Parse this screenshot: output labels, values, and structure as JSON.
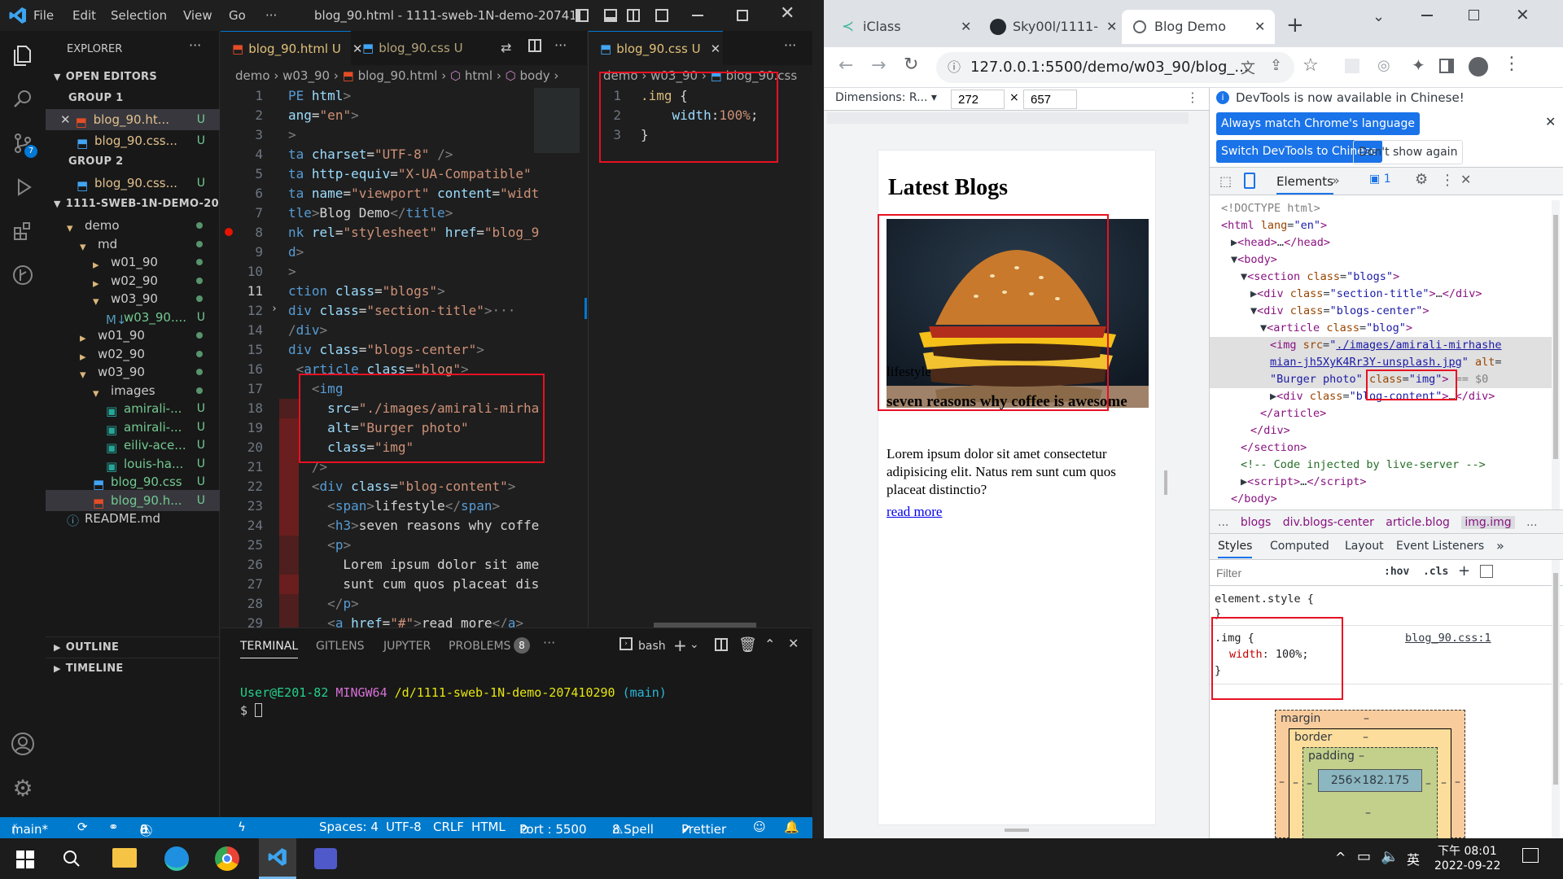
{
  "vscode": {
    "menu": [
      "File",
      "Edit",
      "Selection",
      "View",
      "Go",
      "···"
    ],
    "window_title": "blog_90.html - 1111-sweb-1N-demo-2074102...",
    "explorer": {
      "title": "EXPLORER",
      "open_editors": "OPEN EDITORS",
      "group1": "GROUP 1",
      "group1_items": [
        {
          "name": "blog_90.ht...",
          "badge": "U"
        },
        {
          "name": "blog_90.css...",
          "badge": "U"
        }
      ],
      "group2": "GROUP 2",
      "group2_items": [
        {
          "name": "blog_90.css...",
          "badge": "U"
        }
      ],
      "project": "1111-SWEB-1N-DEMO-20...",
      "tree": [
        {
          "name": "demo",
          "depth": 1,
          "kind": "folder-open"
        },
        {
          "name": "md",
          "depth": 2,
          "kind": "folder-open"
        },
        {
          "name": "w01_90",
          "depth": 3,
          "kind": "folder"
        },
        {
          "name": "w02_90",
          "depth": 3,
          "kind": "folder"
        },
        {
          "name": "w03_90",
          "depth": 3,
          "kind": "folder-open"
        },
        {
          "name": "w03_90....",
          "depth": 4,
          "kind": "md",
          "badge": "U"
        },
        {
          "name": "w01_90",
          "depth": 2,
          "kind": "folder"
        },
        {
          "name": "w02_90",
          "depth": 2,
          "kind": "folder"
        },
        {
          "name": "w03_90",
          "depth": 2,
          "kind": "folder-open"
        },
        {
          "name": "images",
          "depth": 3,
          "kind": "folder-open"
        },
        {
          "name": "amirali-...",
          "depth": 4,
          "kind": "img",
          "badge": "U"
        },
        {
          "name": "amirali-...",
          "depth": 4,
          "kind": "img",
          "badge": "U"
        },
        {
          "name": "eiliv-ace...",
          "depth": 4,
          "kind": "img",
          "badge": "U"
        },
        {
          "name": "louis-ha...",
          "depth": 4,
          "kind": "img",
          "badge": "U"
        },
        {
          "name": "blog_90.css",
          "depth": 3,
          "kind": "css",
          "badge": "U"
        },
        {
          "name": "blog_90.h...",
          "depth": 3,
          "kind": "html",
          "badge": "U"
        },
        {
          "name": "README.md",
          "depth": 1,
          "kind": "info"
        }
      ],
      "outline": "OUTLINE",
      "timeline": "TIMELINE"
    },
    "editor1": {
      "tabs": [
        {
          "label": "blog_90.html",
          "badge": "U"
        },
        {
          "label": "blog_90.css",
          "badge": "U"
        }
      ],
      "breadcrumb": [
        "demo",
        "w03_90",
        "blog_90.html",
        "html",
        "body"
      ],
      "lines": [
        {
          "n": "1",
          "html": "<span class='k'>PE</span> <span class='a'>html</span><span class='g'>&gt;</span>"
        },
        {
          "n": "2",
          "html": "<span class='a'>ang</span>=<span class='s'>\"en\"</span><span class='g'>&gt;</span>"
        },
        {
          "n": "3",
          "html": "<span class='g'>&gt;</span>"
        },
        {
          "n": "4",
          "html": "<span class='k'>ta</span> <span class='a'>charset</span>=<span class='s'>\"UTF-8\"</span> <span class='g'>/&gt;</span>"
        },
        {
          "n": "5",
          "html": "<span class='k'>ta</span> <span class='a'>http-equiv</span>=<span class='s'>\"X-UA-Compatible\"</span>"
        },
        {
          "n": "6",
          "html": "<span class='k'>ta</span> <span class='a'>name</span>=<span class='s'>\"viewport\"</span> <span class='a'>content</span>=<span class='s'>\"widt</span>"
        },
        {
          "n": "7",
          "html": "<span class='k'>tle</span><span class='g'>&gt;</span>Blog Demo<span class='g'>&lt;/</span><span class='k'>title</span><span class='g'>&gt;</span>"
        },
        {
          "n": "8",
          "html": "<span class='k'>nk</span> <span class='a'>rel</span>=<span class='s'>\"stylesheet\"</span> <span class='a'>href</span>=<span class='s'>\"blog_9</span>"
        },
        {
          "n": "9",
          "html": "<span class='k'>d</span><span class='g'>&gt;</span>"
        },
        {
          "n": "10",
          "html": "<span class='g'>&gt;</span>"
        },
        {
          "n": "11",
          "html": "<span class='k'>ction</span> <span class='a'>class</span>=<span class='s'>\"blogs\"</span><span class='g'>&gt;</span>"
        },
        {
          "n": "12",
          "html": "<span class='k'>div</span> <span class='a'>class</span>=<span class='s'>\"section-title\"</span><span class='g'>&gt;</span><span class='g'>···</span>"
        },
        {
          "n": "14",
          "html": "<span class='g'>/</span><span class='k'>div</span><span class='g'>&gt;</span>"
        },
        {
          "n": "15",
          "html": "<span class='k'>div</span> <span class='a'>class</span>=<span class='s'>\"blogs-center\"</span><span class='g'>&gt;</span>"
        },
        {
          "n": "16",
          "html": " <span class='g'>&lt;</span><span class='k'>article</span> <span class='a'>class</span>=<span class='s'>\"blog\"</span><span class='g'>&gt;</span>"
        },
        {
          "n": "17",
          "html": "   <span class='g'>&lt;</span><span class='k'>img</span>"
        },
        {
          "n": "18",
          "html": "     <span class='a'>src</span>=<span class='s'>\"./images/amirali-mirha</span>"
        },
        {
          "n": "19",
          "html": "     <span class='a'>alt</span>=<span class='s'>\"Burger photo\"</span>"
        },
        {
          "n": "20",
          "html": "     <span class='a'>class</span>=<span class='s'>\"img\"</span>"
        },
        {
          "n": "21",
          "html": "   <span class='g'>/&gt;</span>"
        },
        {
          "n": "22",
          "html": "   <span class='g'>&lt;</span><span class='k'>div</span> <span class='a'>class</span>=<span class='s'>\"blog-content\"</span><span class='g'>&gt;</span>"
        },
        {
          "n": "23",
          "html": "     <span class='g'>&lt;</span><span class='k'>span</span><span class='g'>&gt;</span>lifestyle<span class='g'>&lt;/</span><span class='k'>span</span><span class='g'>&gt;</span>"
        },
        {
          "n": "24",
          "html": "     <span class='g'>&lt;</span><span class='k'>h3</span><span class='g'>&gt;</span>seven reasons why coffe"
        },
        {
          "n": "25",
          "html": "     <span class='g'>&lt;</span><span class='k'>p</span><span class='g'>&gt;</span>"
        },
        {
          "n": "26",
          "html": "       Lorem ipsum dolor sit ame"
        },
        {
          "n": "27",
          "html": "       sunt cum quos placeat dis"
        },
        {
          "n": "28",
          "html": "     <span class='g'>&lt;/</span><span class='k'>p</span><span class='g'>&gt;</span>"
        },
        {
          "n": "29",
          "html": "     <span class='g'>&lt;</span><span class='k'>a</span> <span class='a'>href</span>=<span class='s'>\"#\"</span><span class='g'>&gt;</span>read more<span class='g'>&lt;/</span><span class='k'>a</span><span class='g'>&gt;</span>"
        }
      ]
    },
    "editor2": {
      "tab": {
        "label": "blog_90.css",
        "badge": "U"
      },
      "breadcrumb": [
        "demo",
        "w03_90",
        "blog_90.css"
      ],
      "lines": [
        {
          "n": "1",
          "html": "<span class='sel'>.img</span> <span class='t'>{</span>"
        },
        {
          "n": "2",
          "html": "    <span class='p'>width</span>:<span class='s'>100%</span>;"
        },
        {
          "n": "3",
          "html": "<span class='t'>}</span>"
        }
      ]
    },
    "panel": {
      "tabs": [
        "TERMINAL",
        "GITLENS",
        "JUPYTER",
        "PROBLEMS"
      ],
      "problems_count": "8",
      "shell": "bash",
      "prompt_user": "User@E201-82",
      "prompt_env": "MINGW64",
      "prompt_path": "/d/1111-sweb-1N-demo-207410290",
      "prompt_branch": "(main)",
      "prompt_symbol": "$"
    },
    "status": {
      "branch": "main*",
      "errors": "0",
      "warnings": "0",
      "info": "8",
      "spaces": "Spaces: 4",
      "encoding": "UTF-8",
      "eol": "CRLF",
      "lang": "HTML",
      "port": "Port : 5500",
      "spell": "8 Spell",
      "prettier": "Prettier"
    }
  },
  "chrome": {
    "tabs": [
      "iClass",
      "Sky00l/1111-",
      "Blog Demo"
    ],
    "url": "127.0.0.1:5500/demo/w03_90/blog_...",
    "dimensions_label": "Dimensions: R...",
    "width": "272",
    "height": "657",
    "page": {
      "heading": "Latest Blogs",
      "category": "lifestyle",
      "title": "seven reasons why coffee is awesome",
      "body": "Lorem ipsum dolor sit amet consectetur adipisicing elit. Natus rem sunt cum quos placeat distinctio?",
      "link": "read more"
    },
    "devtools": {
      "banner": "DevTools is now available in Chinese!",
      "btn1": "Always match Chrome's language",
      "btn2": "Switch DevTools to Chinese",
      "btn3": "Don't show again",
      "elements_tab": "Elements",
      "issues": "1",
      "dom": [
        {
          "indent": 0,
          "html": "<span class='g'>&lt;!DOCTYPE html&gt;</span>"
        },
        {
          "indent": 0,
          "html": "<span class='tg'>&lt;html</span> <span class='at'>lang</span>=<span class='av'>\"en\"</span><span class='tg'>&gt;</span>"
        },
        {
          "indent": 1,
          "html": "▶<span class='tg'>&lt;head&gt;</span>…<span class='tg'>&lt;/head&gt;</span>"
        },
        {
          "indent": 1,
          "html": "▼<span class='tg'>&lt;body&gt;</span>"
        },
        {
          "indent": 2,
          "html": "▼<span class='tg'>&lt;section</span> <span class='at'>class</span>=<span class='av'>\"blogs\"</span><span class='tg'>&gt;</span>"
        },
        {
          "indent": 3,
          "html": "▶<span class='tg'>&lt;div</span> <span class='at'>class</span>=<span class='av'>\"section-title\"</span><span class='tg'>&gt;</span>…<span class='tg'>&lt;/div&gt;</span>"
        },
        {
          "indent": 3,
          "html": "▼<span class='tg'>&lt;div</span> <span class='at'>class</span>=<span class='av'>\"blogs-center\"</span><span class='tg'>&gt;</span>"
        },
        {
          "indent": 4,
          "html": "▼<span class='tg'>&lt;article</span> <span class='at'>class</span>=<span class='av'>\"blog\"</span><span class='tg'>&gt;</span>"
        },
        {
          "indent": 5,
          "html": "<span class='tg'>&lt;img</span> <span class='at'>src</span>=<span class='av'>\"<u>./images/amirali-mirhashe</u></span>"
        },
        {
          "indent": 5,
          "html": "<span class='av'><u>mian-jh5XyK4Rr3Y-unsplash.jpg</u>\"</span> <span class='at'>alt</span>="
        },
        {
          "indent": 5,
          "html": "<span class='av'>\"Burger photo\"</span> <span class='at'>class</span>=<span class='av'>\"img\"</span><span class='tg'>&gt;</span> <span class='g'>== $0</span>"
        },
        {
          "indent": 5,
          "html": "▶<span class='tg'>&lt;div</span> <span class='at'>class</span>=<span class='av'>\"blog-content\"</span><span class='tg'>&gt;</span>…<span class='tg'>&lt;/div&gt;</span>"
        },
        {
          "indent": 4,
          "html": "<span class='tg'>&lt;/article&gt;</span>"
        },
        {
          "indent": 3,
          "html": "<span class='tg'>&lt;/div&gt;</span>"
        },
        {
          "indent": 2,
          "html": "<span class='tg'>&lt;/section&gt;</span>"
        },
        {
          "indent": 2,
          "html": "<span class='cm'>&lt;!-- Code injected by live-server --&gt;</span>"
        },
        {
          "indent": 2,
          "html": "▶<span class='tg'>&lt;script&gt;</span>…<span class='tg'>&lt;/script&gt;</span>"
        },
        {
          "indent": 1,
          "html": "<span class='tg'>&lt;/body&gt;</span>"
        }
      ],
      "crumbs": [
        "...",
        "blogs",
        "div.blogs-center",
        "article.blog",
        "img.img",
        "..."
      ],
      "style_tabs": [
        "Styles",
        "Computed",
        "Layout",
        "Event Listeners"
      ],
      "filter_placeholder": "Filter",
      "hov": ":hov",
      "cls": ".cls",
      "element_style": "element.style {",
      "rule_selector": ".img {",
      "rule_source": "blog_90.css:1",
      "rule_prop": "width",
      "rule_val": "100%;",
      "box": {
        "margin": "margin",
        "border": "border",
        "padding": "padding",
        "content": "256×182.175",
        "dash": "–"
      }
    }
  },
  "taskbar": {
    "time": "下午 08:01",
    "date": "2022-09-22",
    "ime": "英"
  }
}
